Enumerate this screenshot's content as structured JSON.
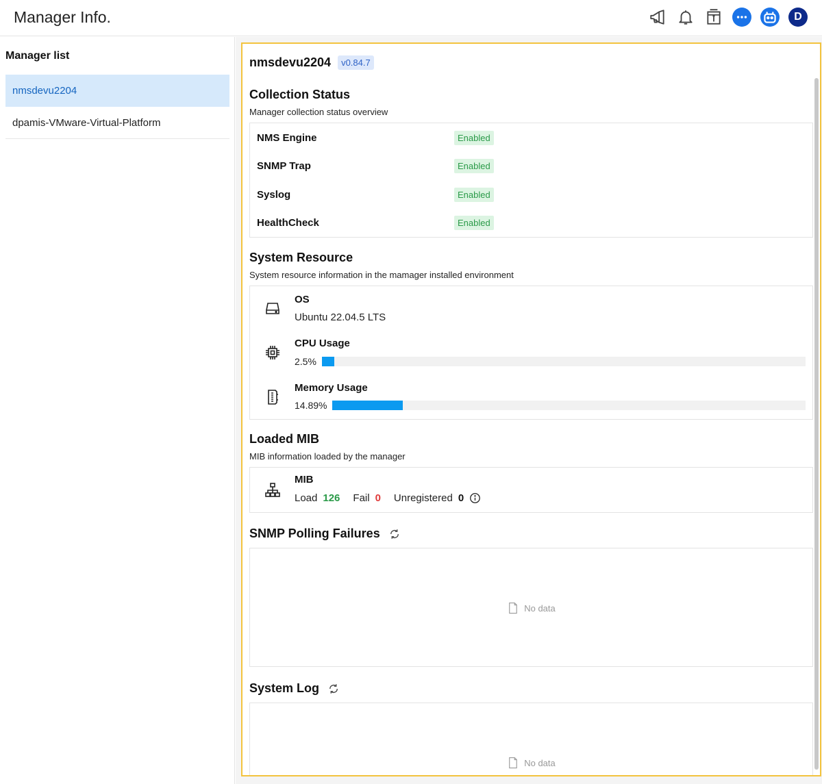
{
  "header": {
    "title": "Manager Info.",
    "icons": [
      "megaphone-icon",
      "bell-icon",
      "info-box-icon",
      "chat-icon",
      "bot-icon"
    ],
    "avatar_initial": "D"
  },
  "sidebar": {
    "title": "Manager list",
    "items": [
      {
        "label": "nmsdevu2204",
        "active": true
      },
      {
        "label": "dpamis-VMware-Virtual-Platform",
        "active": false
      }
    ]
  },
  "main": {
    "manager_name": "nmsdevu2204",
    "version": "v0.84.7",
    "collection": {
      "title": "Collection Status",
      "subtitle": "Manager collection status overview",
      "rows": [
        {
          "label": "NMS Engine",
          "status": "Enabled"
        },
        {
          "label": "SNMP Trap",
          "status": "Enabled"
        },
        {
          "label": "Syslog",
          "status": "Enabled"
        },
        {
          "label": "HealthCheck",
          "status": "Enabled"
        }
      ]
    },
    "resource": {
      "title": "System Resource",
      "subtitle": "System resource information in the mamager installed environment",
      "os_label": "OS",
      "os_value": "Ubuntu 22.04.5 LTS",
      "cpu_label": "CPU Usage",
      "cpu_pct_text": "2.5%",
      "cpu_pct": 2.5,
      "mem_label": "Memory Usage",
      "mem_pct_text": "14.89%",
      "mem_pct": 14.89
    },
    "mib": {
      "title": "Loaded MIB",
      "subtitle": "MIB information loaded by the manager",
      "label": "MIB",
      "load_label": "Load",
      "load_value": "126",
      "fail_label": "Fail",
      "fail_value": "0",
      "unregistered_label": "Unregistered",
      "unregistered_value": "0"
    },
    "polling": {
      "title": "SNMP Polling Failures",
      "empty_text": "No data"
    },
    "syslog": {
      "title": "System Log",
      "empty_text": "No data"
    }
  },
  "colors": {
    "accent": "#1a73e8",
    "highlight_border": "#f3c33d",
    "enabled_bg": "#dcf4e2",
    "enabled_text": "#2a9a48",
    "bar_fill": "#0b9af0",
    "fail_text": "#e03b3b"
  }
}
